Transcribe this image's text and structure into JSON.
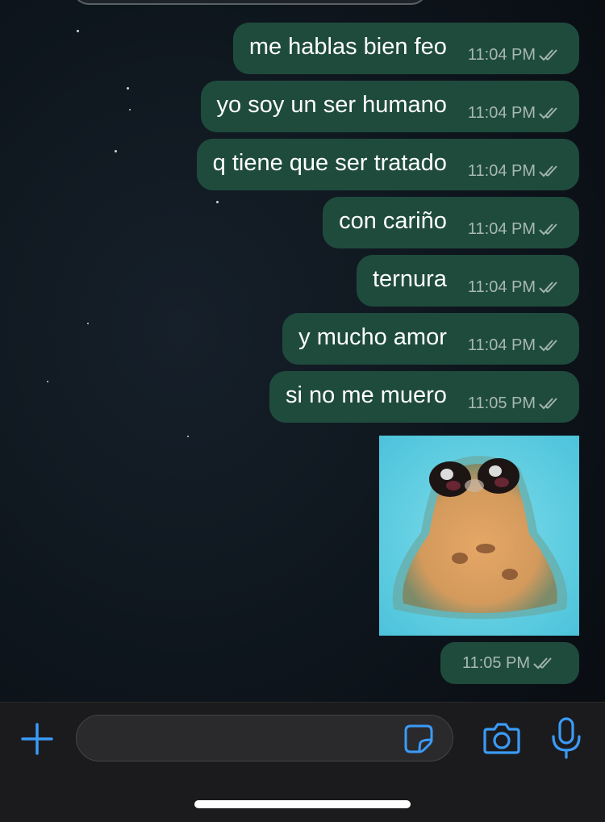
{
  "chat": {
    "messages": [
      {
        "text": "me hablas bien feo",
        "time": "11:04 PM"
      },
      {
        "text": "yo soy un ser humano",
        "time": "11:04 PM"
      },
      {
        "text": "q tiene que ser tratado",
        "time": "11:04 PM"
      },
      {
        "text": "con cariño",
        "time": "11:04 PM"
      },
      {
        "text": "ternura",
        "time": "11:04 PM"
      },
      {
        "text": "y mucho amor",
        "time": "11:04 PM"
      },
      {
        "text": "si no me muero",
        "time": "11:05 PM"
      }
    ],
    "sticker": {
      "time": "11:05 PM"
    }
  },
  "composer": {
    "input_value": "",
    "input_placeholder": ""
  },
  "icons": {
    "add": "plus-icon",
    "sticker": "sticker-icon",
    "camera": "camera-icon",
    "mic": "microphone-icon",
    "read_receipt": "double-check-icon"
  },
  "colors": {
    "outgoing_bubble": "#1f4b3d",
    "accent": "#3b9bf6",
    "composer_bg": "#1b1b1d"
  }
}
